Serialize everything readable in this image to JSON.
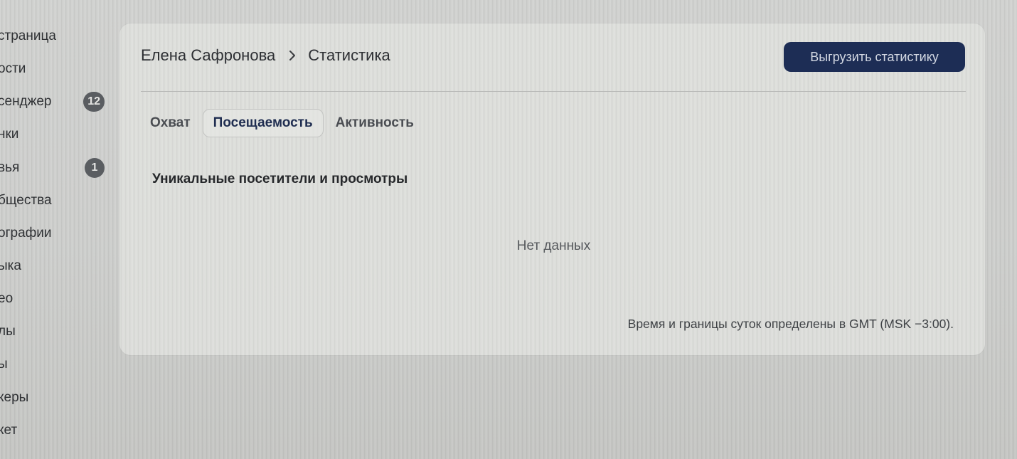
{
  "sidebar": {
    "items": [
      {
        "label": "страница",
        "badge": null
      },
      {
        "label": "ости",
        "badge": null
      },
      {
        "label": "сенджер",
        "badge": "12"
      },
      {
        "label": "нки",
        "badge": null
      },
      {
        "label": "вья",
        "badge": "1"
      },
      {
        "label": "бщества",
        "badge": null
      },
      {
        "label": "ографии",
        "badge": null
      },
      {
        "label": "ыка",
        "badge": null
      },
      {
        "label": "ео",
        "badge": null
      },
      {
        "label": "лы",
        "badge": null
      },
      {
        "label": "ы",
        "badge": null
      },
      {
        "label": "керы",
        "badge": null
      },
      {
        "label": "кет",
        "badge": null
      }
    ]
  },
  "header": {
    "breadcrumb": {
      "owner": "Елена Сафронова",
      "page": "Статистика",
      "separator_icon": "chevron-right-icon"
    },
    "export_button_label": "Выгрузить статистику"
  },
  "tabs": [
    {
      "label": "Охват",
      "active": false
    },
    {
      "label": "Посещаемость",
      "active": true
    },
    {
      "label": "Активность",
      "active": false
    }
  ],
  "section": {
    "title": "Уникальные посетители и просмотры",
    "empty_text": "Нет данных"
  },
  "footer": {
    "timezone_note": "Время и границы суток определены в GMT (MSK −3:00)."
  },
  "colors": {
    "accent_button": "#1d2d55",
    "page_background": "#cfd0ce",
    "card_background": "#dedfdc",
    "badge_background": "#5a5d61"
  }
}
